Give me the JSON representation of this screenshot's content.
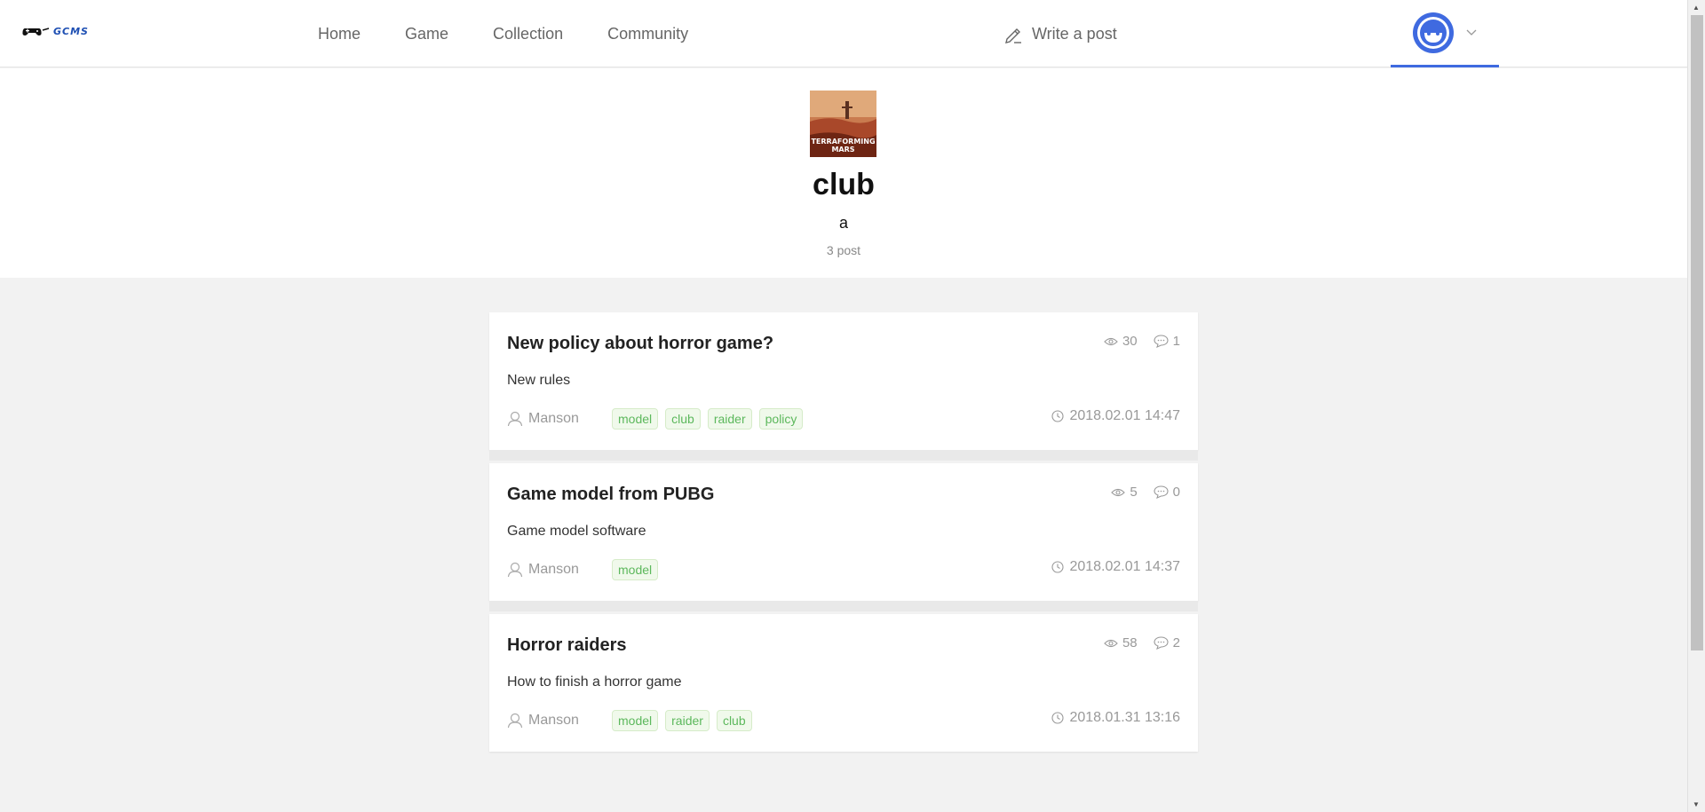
{
  "header": {
    "logo_text": "GCMS",
    "nav": [
      "Home",
      "Game",
      "Collection",
      "Community"
    ],
    "write_label": "Write a post"
  },
  "club": {
    "cover_text_1": "TERRAFORMING",
    "cover_text_2": "MARS",
    "title": "club",
    "description": "a",
    "post_count": "3 post"
  },
  "posts": [
    {
      "title": "New policy about horror game?",
      "views": "30",
      "comments": "1",
      "body": "New rules",
      "author": "Manson",
      "tags": [
        "model",
        "club",
        "raider",
        "policy"
      ],
      "date": "2018.02.01 14:47"
    },
    {
      "title": "Game model from PUBG",
      "views": "5",
      "comments": "0",
      "body": "Game model software",
      "author": "Manson",
      "tags": [
        "model"
      ],
      "date": "2018.02.01 14:37"
    },
    {
      "title": "Horror raiders",
      "views": "58",
      "comments": "2",
      "body": "How to finish a horror game",
      "author": "Manson",
      "tags": [
        "model",
        "raider",
        "club"
      ],
      "date": "2018.01.31 13:16"
    }
  ],
  "colors": {
    "accent": "#3f6ae0",
    "tag_text": "#5cb85c",
    "tag_bg": "#f0f9eb"
  }
}
